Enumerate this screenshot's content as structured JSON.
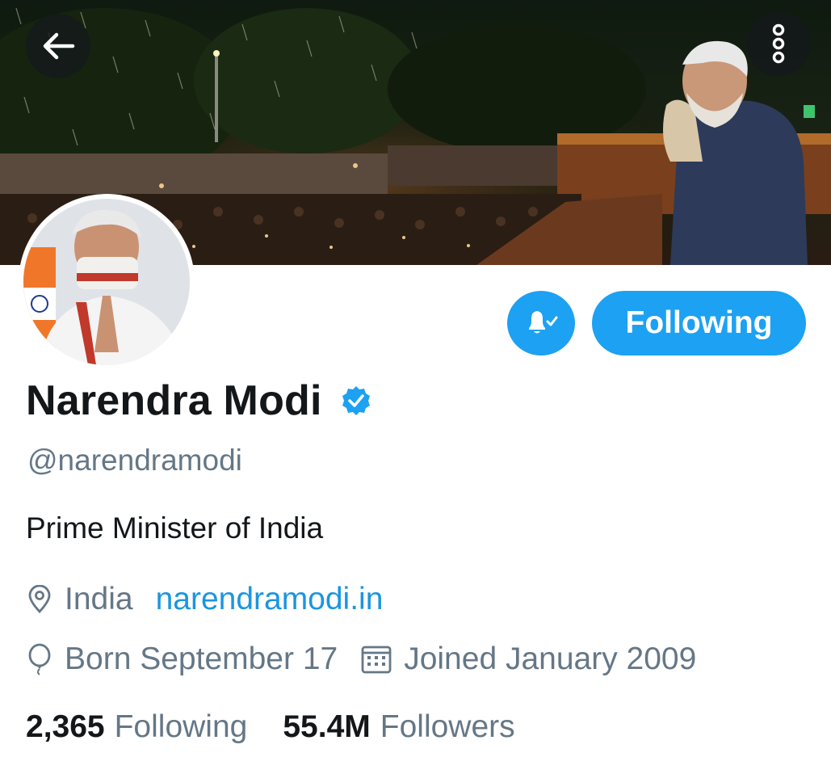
{
  "header": {
    "back_icon": "arrow-left-icon",
    "more_icon": "more-vertical-icon"
  },
  "profile": {
    "name": "Narendra Modi",
    "verified_icon": "verified-badge-icon",
    "handle": "@narendramodi",
    "bio": "Prime Minister of India",
    "location": "India",
    "website": "narendramodi.in",
    "born": "Born September 17",
    "joined": "Joined January 2009"
  },
  "actions": {
    "notifications_icon": "bell-check-icon",
    "follow_label": "Following"
  },
  "stats": {
    "following_count": "2,365",
    "following_label": "Following",
    "followers_count": "55.4M",
    "followers_label": "Followers"
  },
  "colors": {
    "accent": "#1da1f2",
    "link": "#1b95e0",
    "secondary_text": "#657786",
    "primary_text": "#14171a"
  }
}
